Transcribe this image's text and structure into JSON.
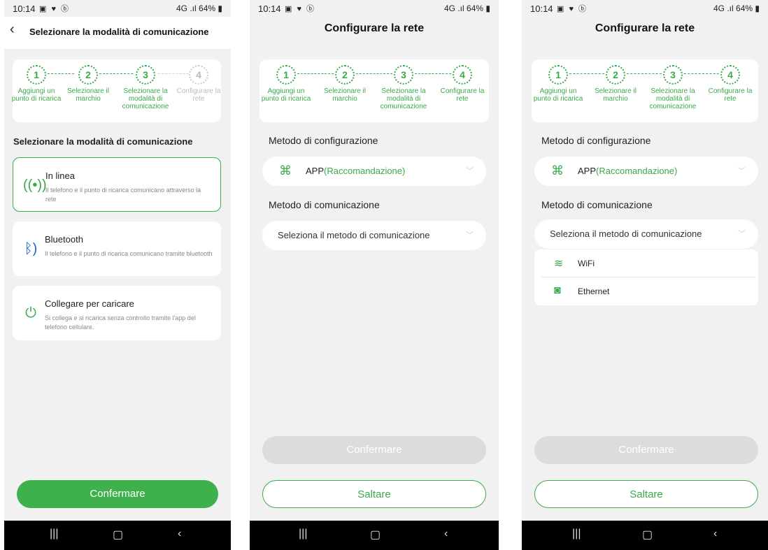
{
  "status": {
    "time": "10:14",
    "icons": "▣ ♥ ⓑ",
    "network": "4G .ıl",
    "battery": "64%"
  },
  "steps": [
    {
      "num": "1",
      "label": "Aggiungi un punto di ricarica"
    },
    {
      "num": "2",
      "label": "Selezionare il marchio"
    },
    {
      "num": "3",
      "label": "Selezionare la modalità di comunicazione"
    },
    {
      "num": "4",
      "label": "Configurare la rete"
    }
  ],
  "screen1": {
    "title": "Selezionare la modalità di comunicazione",
    "section_title": "Selezionare la modalità di comunicazione",
    "options": [
      {
        "title": "In linea",
        "desc": "Il telefono e il punto di ricarica comunicano attraverso la rete"
      },
      {
        "title": "Bluetooth",
        "desc": "Il telefono e il punto di ricarica comunicano tramite bluetooth"
      },
      {
        "title": "Collegare per caricare",
        "desc": "Si collega e si ricarica senza controllo tramite l'app del telefono cellulare."
      }
    ],
    "confirm_label": "Confermare"
  },
  "screen2": {
    "title": "Configurare la rete",
    "config_method_label": "Metodo di configurazione",
    "config_value_prefix": "APP",
    "config_value_suffix": "(Raccomandazione)",
    "comm_method_label": "Metodo di comunicazione",
    "comm_placeholder": "Seleziona il metodo di comunicazione",
    "confirm_label": "Confermare",
    "skip_label": "Saltare"
  },
  "screen3": {
    "dropdown_options": [
      "WiFi",
      "Ethernet"
    ]
  },
  "colors": {
    "accent": "#3fb14c",
    "disabled": "#dcdcdc"
  }
}
